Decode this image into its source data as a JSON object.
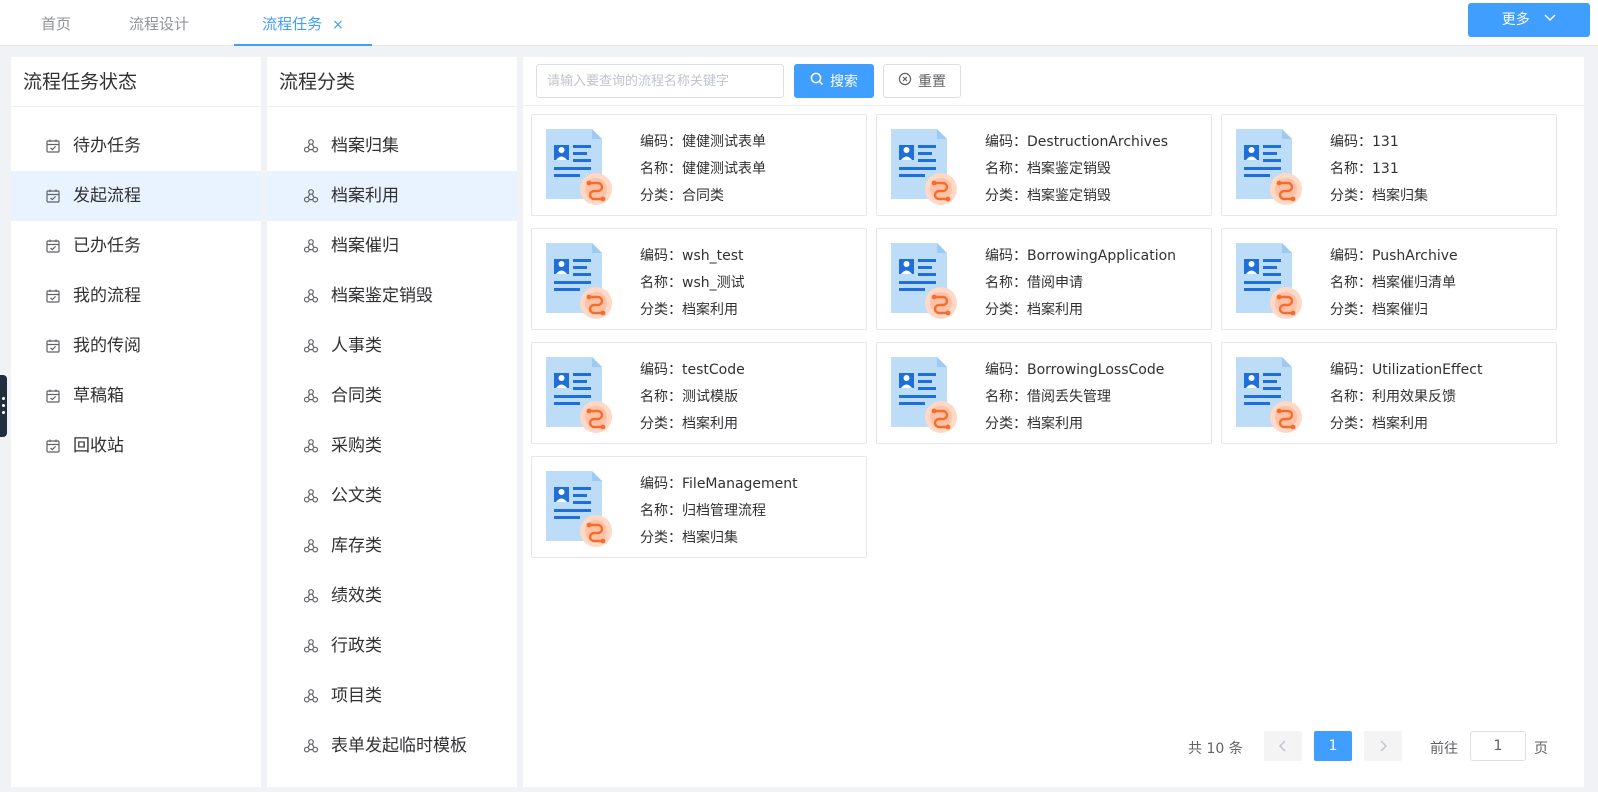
{
  "tabs": [
    {
      "label": "首页",
      "active": false
    },
    {
      "label": "流程设计",
      "active": false
    },
    {
      "label": "流程任务",
      "active": true,
      "close": "×"
    }
  ],
  "more_button": {
    "label": "更多"
  },
  "status_panel": {
    "title": "流程任务状态",
    "items": [
      {
        "label": "待办任务",
        "active": false
      },
      {
        "label": "发起流程",
        "active": true
      },
      {
        "label": "已办任务",
        "active": false
      },
      {
        "label": "我的流程",
        "active": false
      },
      {
        "label": "我的传阅",
        "active": false
      },
      {
        "label": "草稿箱",
        "active": false
      },
      {
        "label": "回收站",
        "active": false
      }
    ]
  },
  "category_panel": {
    "title": "流程分类",
    "items": [
      {
        "label": "档案归集",
        "active": false
      },
      {
        "label": "档案利用",
        "active": true
      },
      {
        "label": "档案催归",
        "active": false
      },
      {
        "label": "档案鉴定销毁",
        "active": false
      },
      {
        "label": "人事类",
        "active": false
      },
      {
        "label": "合同类",
        "active": false
      },
      {
        "label": "采购类",
        "active": false
      },
      {
        "label": "公文类",
        "active": false
      },
      {
        "label": "库存类",
        "active": false
      },
      {
        "label": "绩效类",
        "active": false
      },
      {
        "label": "行政类",
        "active": false
      },
      {
        "label": "项目类",
        "active": false
      },
      {
        "label": "表单发起临时模板",
        "active": false
      }
    ]
  },
  "search": {
    "placeholder": "请输入要查询的流程名称关键字",
    "value": "",
    "search_label": "搜索",
    "reset_label": "重置"
  },
  "field_labels": {
    "code": "编码：",
    "name": "名称：",
    "category": "分类："
  },
  "cards": [
    {
      "code": "健健测试表单",
      "name": "健健测试表单",
      "category": "合同类"
    },
    {
      "code": "DestructionArchives",
      "name": "档案鉴定销毁",
      "category": "档案鉴定销毁"
    },
    {
      "code": "131",
      "name": "131",
      "category": "档案归集"
    },
    {
      "code": "wsh_test",
      "name": "wsh_测试",
      "category": "档案利用"
    },
    {
      "code": "BorrowingApplication",
      "name": "借阅申请",
      "category": "档案利用"
    },
    {
      "code": "PushArchive",
      "name": "档案催归清单",
      "category": "档案催归"
    },
    {
      "code": "testCode",
      "name": "测试模版",
      "category": "档案利用"
    },
    {
      "code": "BorrowingLossCode",
      "name": "借阅丢失管理",
      "category": "档案利用"
    },
    {
      "code": "UtilizationEffect",
      "name": "利用效果反馈",
      "category": "档案利用"
    },
    {
      "code": "FileManagement",
      "name": "归档管理流程",
      "category": "档案归集"
    }
  ],
  "pagination": {
    "total_text": "共 10 条",
    "current_page": "1",
    "goto_label": "前往",
    "goto_value": "1",
    "page_suffix": "页"
  },
  "colors": {
    "primary": "#409eff",
    "active_bg": "#e8f3ff",
    "icon_red": "#f56c2c"
  }
}
